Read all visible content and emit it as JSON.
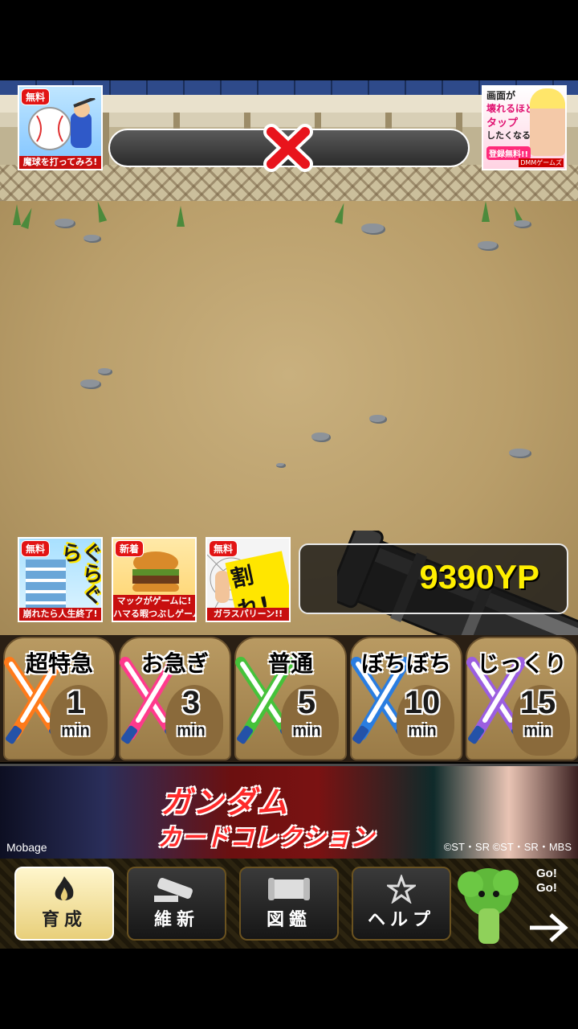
{
  "top_ads": {
    "left": {
      "tag": "無料",
      "caption": "魔球を打ってみろ!"
    },
    "right": {
      "line1": "画面が",
      "line2": "壊れるほど",
      "line3": "タップ",
      "line4": "したくなる!",
      "badge": "登録無料!!",
      "brand": "DMMゲームズ"
    }
  },
  "status": {
    "icon": "close-x-icon"
  },
  "mid_ads": [
    {
      "tag": "無料",
      "caption": "崩れたら人生終了!",
      "art_text": "ぐらぐら"
    },
    {
      "tag": "新着",
      "caption1": "マックがゲームに!",
      "caption2": "ハマる暇つぶしゲーム"
    },
    {
      "tag": "無料",
      "caption": "ガラスパリーン!!",
      "art_text": "割れ!"
    }
  ],
  "points": {
    "value": "9390YP"
  },
  "speeds": [
    {
      "label": "超特急",
      "num": "1",
      "unit": "min",
      "color": "#ff7a1a"
    },
    {
      "label": "お急ぎ",
      "num": "3",
      "unit": "min",
      "color": "#ff3a8c"
    },
    {
      "label": "普通",
      "num": "5",
      "unit": "min",
      "color": "#46c23a"
    },
    {
      "label": "ぼちぼち",
      "num": "10",
      "unit": "min",
      "color": "#2a7de0"
    },
    {
      "label": "じっくり",
      "num": "15",
      "unit": "min",
      "color": "#9b5ee0"
    }
  ],
  "banner": {
    "title": "ガンダム",
    "subtitle": "カードコレクション",
    "brand": "Mobage",
    "copyright": "©ST・SR ©ST・SR・MBS"
  },
  "nav": [
    {
      "label": "育成",
      "icon": "flame-icon",
      "active": true
    },
    {
      "label": "維新",
      "icon": "cannon-icon",
      "active": false
    },
    {
      "label": "図鑑",
      "icon": "scroll-icon",
      "active": false
    },
    {
      "label": "ヘルプ",
      "icon": "star-icon",
      "active": false
    }
  ],
  "mascot": {
    "text1": "Go!",
    "text2": "Go!"
  }
}
